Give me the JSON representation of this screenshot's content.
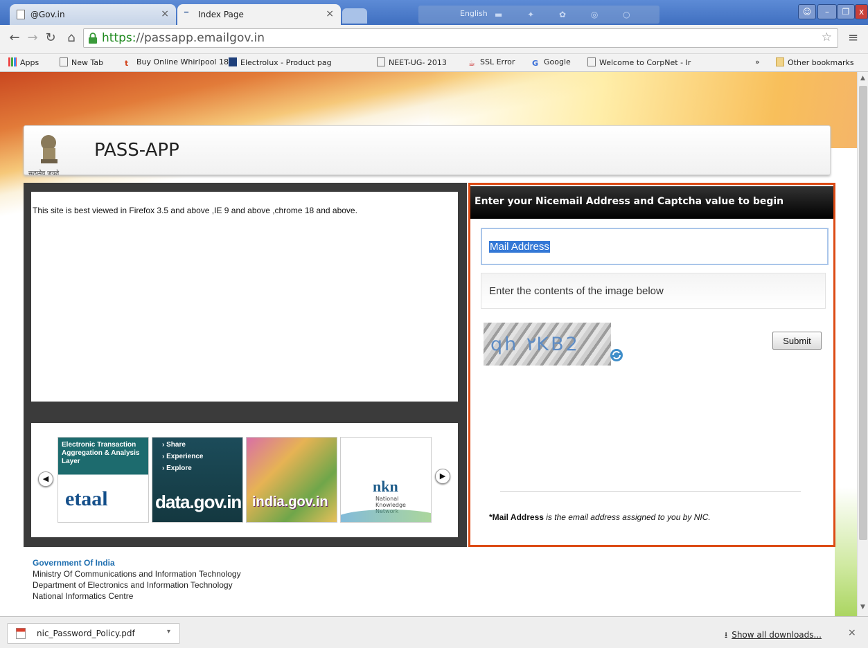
{
  "browser": {
    "tabs": [
      {
        "title": "@Gov.in"
      },
      {
        "title": "Index Page"
      }
    ],
    "ime_bar_label": "English",
    "address": {
      "scheme": "https:",
      "rest": "//passapp.emailgov.in"
    },
    "bookmarks": [
      {
        "label": "Apps"
      },
      {
        "label": "New Tab"
      },
      {
        "label": "Buy Online Whirlpool 18("
      },
      {
        "label": "Electrolux - Product pag"
      },
      {
        "label": "NEET-UG- 2013"
      },
      {
        "label": "SSL Error"
      },
      {
        "label": "Google"
      },
      {
        "label": "Welcome to CorpNet - Ir"
      },
      {
        "label": "Other bookmarks"
      }
    ],
    "bookmarks_overflow": "»"
  },
  "page": {
    "site_title": "PASS-APP",
    "emblem_caption": "सत्यमेव जयते",
    "info_text": "This site is best viewed in Firefox 3.5 and above ,IE 9 and above ,chrome 18 and above.",
    "carousel": {
      "tile1_text": "Electronic Transaction Aggregation & Analysis Layer",
      "tile1_brand": "etaal",
      "tile2_items": [
        "› Share",
        "› Experience",
        "› Explore"
      ],
      "tile2_brand": "data.gov.in",
      "tile3_brand": "india.gov.in",
      "tile4_logo": "nkn",
      "tile4_text": "National Knowledge Network"
    },
    "login": {
      "heading": "Enter your Nicemail Address and Captcha value to begin",
      "mail_value": "Mail Address",
      "captcha_placeholder": "Enter the contents of the image below",
      "captcha_text": "qh ٢KB2",
      "submit_label": "Submit",
      "note_bold": "*Mail Address",
      "note_italic": " is the email address assigned to you by NIC."
    },
    "footer": {
      "line1": "Government Of India",
      "line2": "Ministry Of Communications and Information Technology",
      "line3": "Department of Electronics and Information Technology",
      "line4": "National Informatics Centre"
    }
  },
  "downloads": {
    "file_name": "nic_Password_Policy.pdf",
    "show_all_label": "Show all downloads...",
    "close_glyph": "×"
  },
  "colors": {
    "accent_border": "#dc4a14",
    "header_dark": "#000000",
    "footer_link": "#1f6fb0"
  }
}
